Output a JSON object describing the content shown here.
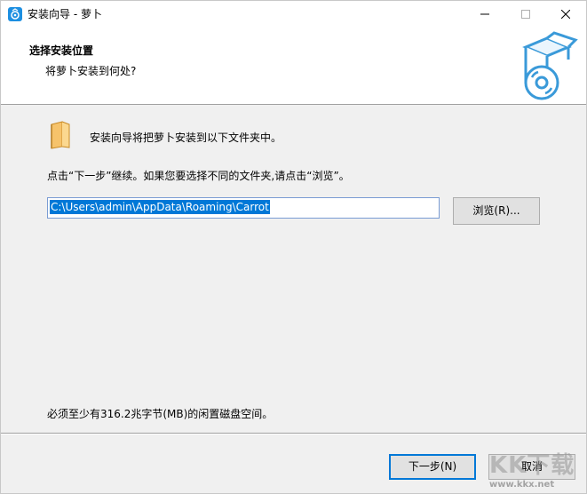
{
  "window": {
    "title": "安装向导 - 萝卜",
    "controls": [
      "minimize-icon",
      "maximize-icon",
      "close-icon"
    ]
  },
  "header": {
    "title": "选择安装位置",
    "subtitle": "将萝卜安装到何处?"
  },
  "body": {
    "intro": "安装向导将把萝卜安装到以下文件夹中。",
    "instruction": "点击“下一步”继续。如果您要选择不同的文件夹,请点击“浏览”。",
    "install_path": "C:\\Users\\admin\\AppData\\Roaming\\Carrot",
    "browse_label": "浏览(R)...",
    "space_required": "必须至少有316.2兆字节(MB)的闲置磁盘空间。"
  },
  "footer": {
    "next_label": "下一步(N)",
    "cancel_label": "取消"
  },
  "watermark": {
    "url": "www.kkx.net"
  },
  "colors": {
    "accent": "#0078d7",
    "selection": "#0078d7",
    "folder": "#f6c36b",
    "box_icon": "#3a9ad9"
  }
}
